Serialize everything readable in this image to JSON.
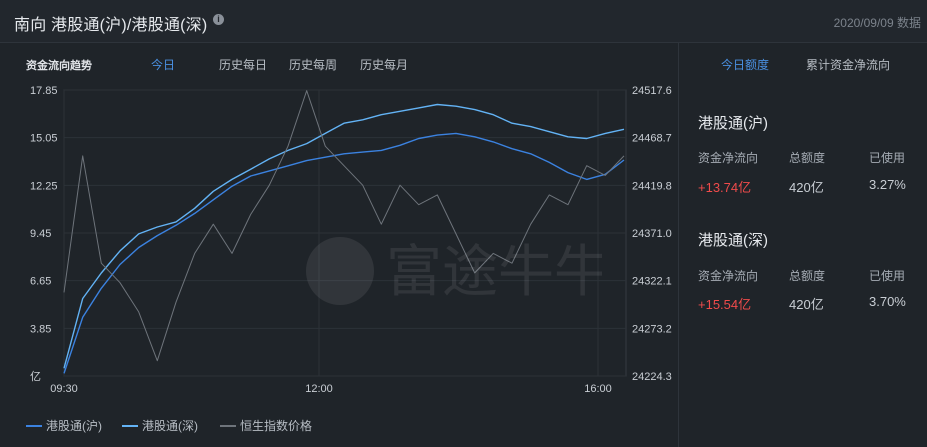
{
  "header": {
    "title": "南向 港股通(沪)/港股通(深)",
    "info_icon": "info-icon",
    "date": "2020/09/09 数据"
  },
  "left_tabs": {
    "label": "资金流向趋势",
    "items": [
      "今日",
      "历史每日",
      "历史每周",
      "历史每月"
    ],
    "active": 0
  },
  "chart_data": {
    "type": "line",
    "left_axis_ticks": [
      "17.85",
      "15.05",
      "12.25",
      "9.45",
      "6.65",
      "3.85",
      "亿"
    ],
    "left_ylim": [
      1.05,
      17.85
    ],
    "right_axis_ticks": [
      "24517.6",
      "24468.7",
      "24419.8",
      "24371.0",
      "24322.1",
      "24273.2",
      "24224.3"
    ],
    "right_ylim": [
      24224.3,
      24517.6
    ],
    "x_ticks": [
      "09:30",
      "12:00",
      "16:00"
    ],
    "legend": [
      "港股通(沪)",
      "港股通(深)",
      "恒生指数价格"
    ],
    "series": [
      {
        "name": "港股通(沪)",
        "color": "#3b82e0",
        "axis": "left",
        "values": [
          1.2,
          4.5,
          6.2,
          7.6,
          8.6,
          9.3,
          9.9,
          10.6,
          11.4,
          12.2,
          12.8,
          13.1,
          13.4,
          13.7,
          13.9,
          14.1,
          14.2,
          14.3,
          14.6,
          15.0,
          15.2,
          15.3,
          15.1,
          14.8,
          14.4,
          14.1,
          13.6,
          13.0,
          12.6,
          12.9,
          13.74
        ]
      },
      {
        "name": "港股通(深)",
        "color": "#63b3f5",
        "axis": "left",
        "values": [
          1.5,
          5.6,
          7.1,
          8.4,
          9.4,
          9.8,
          10.1,
          10.9,
          11.9,
          12.6,
          13.2,
          13.8,
          14.3,
          14.7,
          15.3,
          15.9,
          16.1,
          16.4,
          16.6,
          16.8,
          17.0,
          16.9,
          16.7,
          16.4,
          15.9,
          15.7,
          15.4,
          15.1,
          15.0,
          15.3,
          15.54
        ]
      },
      {
        "name": "恒生指数价格",
        "color": "#6e747b",
        "axis": "right",
        "values": [
          24310,
          24450,
          24340,
          24320,
          24290,
          24240,
          24300,
          24350,
          24380,
          24350,
          24390,
          24420,
          24460,
          24517,
          24460,
          24440,
          24420,
          24380,
          24420,
          24400,
          24410,
          24370,
          24330,
          24350,
          24340,
          24380,
          24410,
          24400,
          24440,
          24430,
          24450
        ]
      }
    ]
  },
  "right_tabs": {
    "items": [
      "今日额度",
      "累计资金净流向"
    ],
    "active": 0
  },
  "sh": {
    "title": "港股通(沪)",
    "col1_label": "资金净流向",
    "col2_label": "总额度",
    "col3_label": "已使用",
    "col1_value": "+13.74亿",
    "col2_value": "420亿",
    "col3_value": "3.27%"
  },
  "sz": {
    "title": "港股通(深)",
    "col1_label": "资金净流向",
    "col2_label": "总额度",
    "col3_label": "已使用",
    "col1_value": "+15.54亿",
    "col2_value": "420亿",
    "col3_value": "3.70%"
  },
  "watermark": {
    "text": "富途牛牛"
  }
}
